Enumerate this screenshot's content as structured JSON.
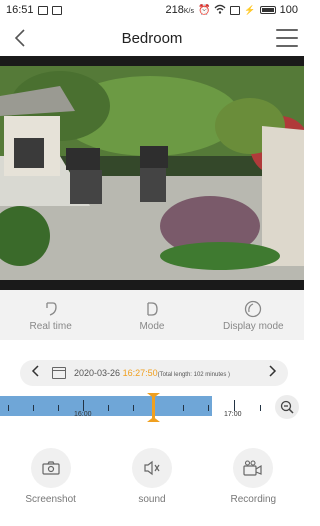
{
  "status_bar": {
    "time": "16:51",
    "network_speed": "218",
    "network_unit": "K/s",
    "battery": "100"
  },
  "nav": {
    "title": "Bedroom",
    "back_icon": "chevron-left-icon",
    "menu_icon": "hamburger-menu-icon"
  },
  "modes": [
    {
      "label": "Real time",
      "icon": "realtime-icon"
    },
    {
      "label": "Mode",
      "icon": "mode-icon"
    },
    {
      "label": "Display mode",
      "icon": "display-mode-icon"
    }
  ],
  "playback": {
    "date": "2020-03-26",
    "time": "16:27:50",
    "total_length": "(Total length: 102 minutes )",
    "timeline_labels": [
      "16:00",
      "17:00"
    ],
    "progress": 0.5
  },
  "actions": [
    {
      "label": "Screenshot",
      "icon": "camera-icon"
    },
    {
      "label": "sound",
      "icon": "speaker-muted-icon"
    },
    {
      "label": "Recording",
      "icon": "video-camera-icon"
    }
  ],
  "colors": {
    "accent": "#f0a020",
    "timeline": "#6fa6d7"
  }
}
